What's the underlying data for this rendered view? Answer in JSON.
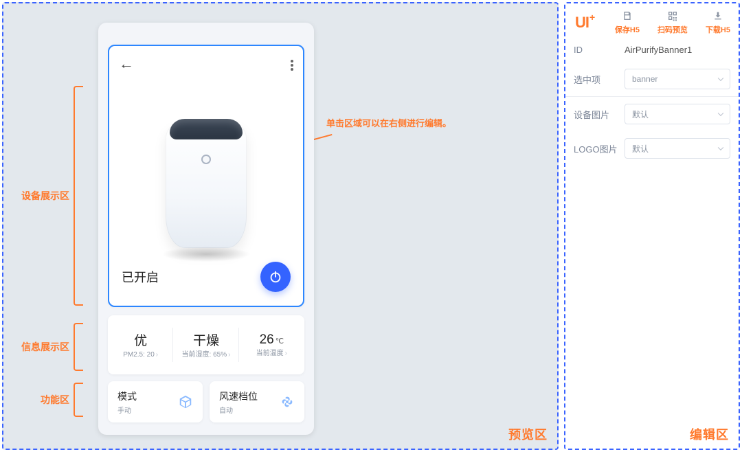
{
  "regions": {
    "preview": "预览区",
    "editor": "编辑区"
  },
  "annotations": {
    "display": "设备展示区",
    "info": "信息展示区",
    "function": "功能区",
    "click_hint": "单击区域可以在右侧进行编辑。"
  },
  "phone": {
    "power_state": "已开启",
    "info": {
      "pm25": {
        "big": "优",
        "sub": "PM2.5: 20"
      },
      "humid": {
        "big": "干燥",
        "sub": "当前湿度: 65%"
      },
      "temp": {
        "big": "26",
        "unit": "℃",
        "sub": "当前温度"
      }
    },
    "func": {
      "mode": {
        "title": "模式",
        "sub": "手动"
      },
      "fan": {
        "title": "风速档位",
        "sub": "自动"
      }
    }
  },
  "editor": {
    "logo": "UI",
    "logo_sup": "+",
    "actions": {
      "save": "保存H5",
      "qr": "扫码预览",
      "download": "下载H5"
    },
    "id_label": "ID",
    "id_value": "AirPurifyBanner1",
    "selected_label": "选中项",
    "selected_value": "banner",
    "device_img_label": "设备图片",
    "device_img_value": "默认",
    "logo_img_label": "LOGO图片",
    "logo_img_value": "默认"
  }
}
